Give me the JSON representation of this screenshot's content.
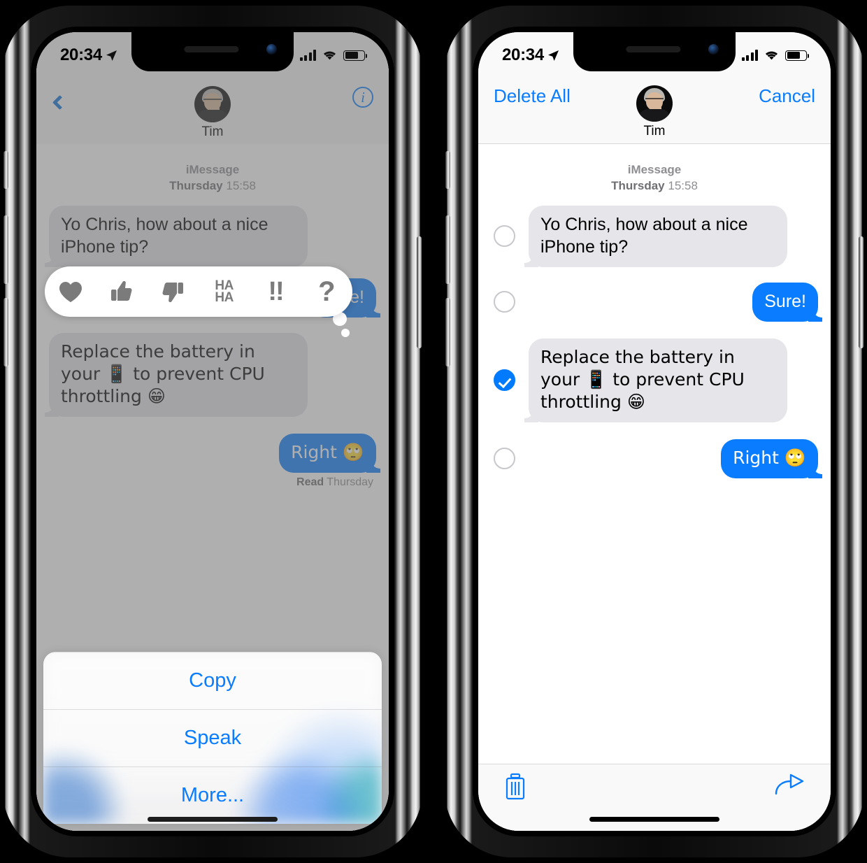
{
  "status_bar": {
    "time": "20:34",
    "location_icon": "location-arrow-icon",
    "signal_icon": "cellular-signal-icon",
    "wifi_icon": "wifi-icon",
    "battery_icon": "battery-icon"
  },
  "contact": {
    "name": "Tim",
    "avatar": "contact-avatar"
  },
  "conversation": {
    "service_label": "iMessage",
    "timestamp_day": "Thursday",
    "timestamp_time": "15:58",
    "messages": [
      {
        "id": "m1",
        "direction": "incoming",
        "text": "Yo Chris, how about a nice iPhone tip?",
        "selected": false
      },
      {
        "id": "m2",
        "direction": "outgoing",
        "text": "Sure!",
        "selected": false
      },
      {
        "id": "m3",
        "direction": "incoming",
        "text": "Replace the battery in your 📱 to prevent CPU throttling 😁",
        "selected": true
      },
      {
        "id": "m4",
        "direction": "outgoing",
        "text": "Right 🙄",
        "selected": false
      }
    ],
    "receipt_status": "Read",
    "receipt_time": "Thursday"
  },
  "left_phone": {
    "nav": {
      "back_icon": "back-chevron-icon",
      "info_icon": "info-circle-icon",
      "info_glyph": "i"
    },
    "tapback": {
      "items": [
        {
          "name": "heart-icon",
          "label": ""
        },
        {
          "name": "thumbs-up-icon",
          "label": ""
        },
        {
          "name": "thumbs-down-icon",
          "label": ""
        },
        {
          "name": "haha-icon",
          "label": "HA\nHA"
        },
        {
          "name": "exclamation-icon",
          "label": "!!"
        },
        {
          "name": "question-icon",
          "label": "?"
        }
      ]
    },
    "action_sheet": {
      "items": [
        {
          "name": "copy-action",
          "label": "Copy"
        },
        {
          "name": "speak-action",
          "label": "Speak"
        },
        {
          "name": "more-action",
          "label": "More..."
        }
      ]
    }
  },
  "right_phone": {
    "nav": {
      "delete_all_label": "Delete All",
      "cancel_label": "Cancel"
    },
    "toolbar": {
      "trash_icon": "trash-icon",
      "forward_icon": "forward-arrow-icon"
    }
  },
  "colors": {
    "accent_blue": "#0a7cff",
    "incoming_bubble": "#e5e5ea",
    "outgoing_bubble": "#0a7cff",
    "selected_check": "#007aff",
    "secondary_text": "#8e8e93",
    "dim_overlay": "#999999"
  }
}
